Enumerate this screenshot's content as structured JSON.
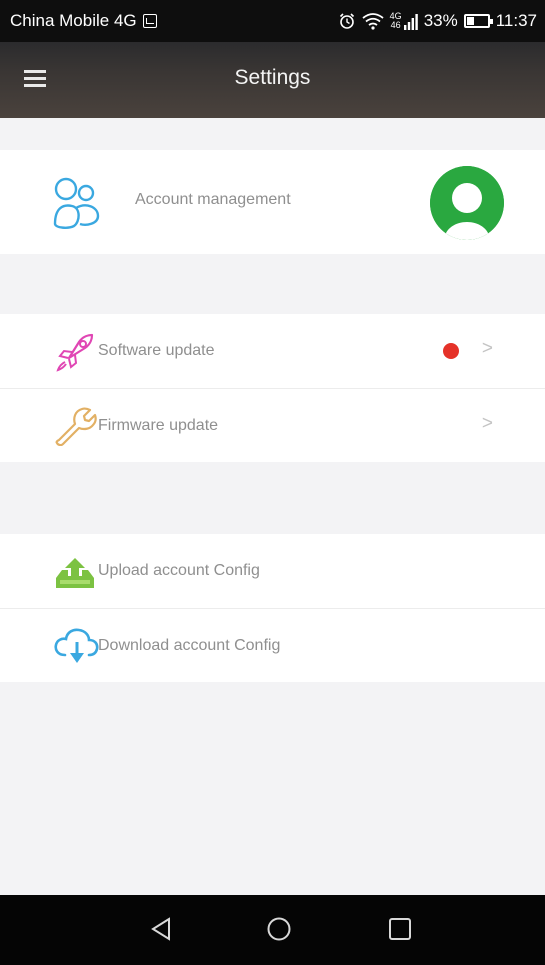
{
  "status_bar": {
    "carrier": "China Mobile 4G",
    "network_label_top": "4G",
    "network_label_bottom": "46",
    "battery_percent": "33%",
    "battery_level": 0.33,
    "time": "11:37",
    "icons": [
      "sim-icon",
      "alarm-icon",
      "wifi-icon",
      "signal-icon",
      "battery-icon"
    ]
  },
  "app_bar": {
    "title": "Settings",
    "menu_icon": "hamburger-menu-icon"
  },
  "account": {
    "label": "Account management",
    "icon": "users-icon",
    "avatar": "avatar-placeholder"
  },
  "updates": [
    {
      "label": "Software update",
      "icon": "rocket-icon",
      "badge": "red-dot",
      "badge_color": "#e53229"
    },
    {
      "label": "Firmware update",
      "icon": "wrench-icon"
    }
  ],
  "config": [
    {
      "label": "Upload account Config",
      "icon": "upload-icon"
    },
    {
      "label": "Download account Config",
      "icon": "download-cloud-icon"
    }
  ],
  "nav_bar": {
    "buttons": [
      "back-icon",
      "home-icon",
      "recents-icon"
    ]
  },
  "colors": {
    "app_bar": "#3a3634",
    "background": "#f3f3f5",
    "row": "#ffffff",
    "label_text": "#8f8f8f",
    "accent_blue": "#3aa8e0",
    "rocket_pink": "#e046b4",
    "wrench_orange": "#e2b064",
    "upload_green": "#7cc242",
    "avatar_green": "#2aa840",
    "badge_red": "#e53229"
  }
}
